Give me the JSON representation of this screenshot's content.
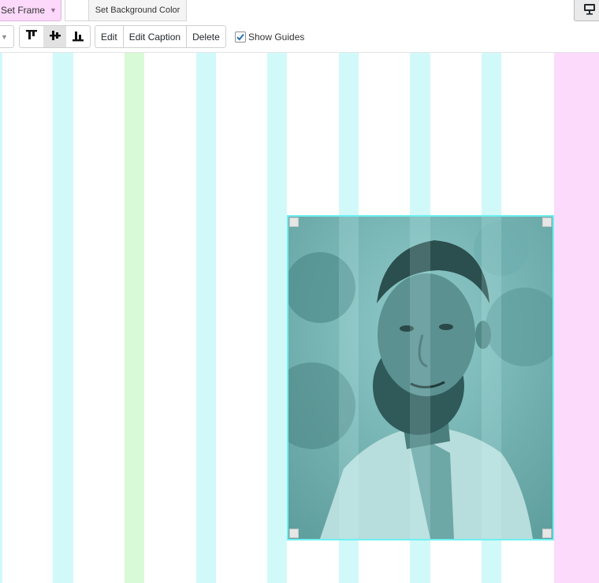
{
  "toolbar": {
    "frame_label": "Set Frame",
    "frame_caret": "▼",
    "background_label": "Set Background Color",
    "device_icon": "desktop-icon"
  },
  "block_toolbar": {
    "caret": "▼",
    "align_buttons": [
      {
        "icon": "align-top-icon",
        "active": false
      },
      {
        "icon": "align-middle-icon",
        "active": true
      },
      {
        "icon": "align-bottom-icon",
        "active": false
      }
    ],
    "actions": [
      "Edit",
      "Edit Caption",
      "Delete"
    ],
    "show_guides_label": "Show Guides",
    "show_guides_checked": true
  },
  "colors": {
    "guide_cyan": "#d2f9fa",
    "guide_green": "#d8fad7",
    "guide_pink": "#fcdafb",
    "frame_button": "#fcd9fb",
    "selection_border": "#6ff0f2",
    "photo_tint": "#7fc5c4"
  },
  "canvas": {
    "image": {
      "subject": "portrait photo of a bearded man",
      "selected": true
    }
  }
}
